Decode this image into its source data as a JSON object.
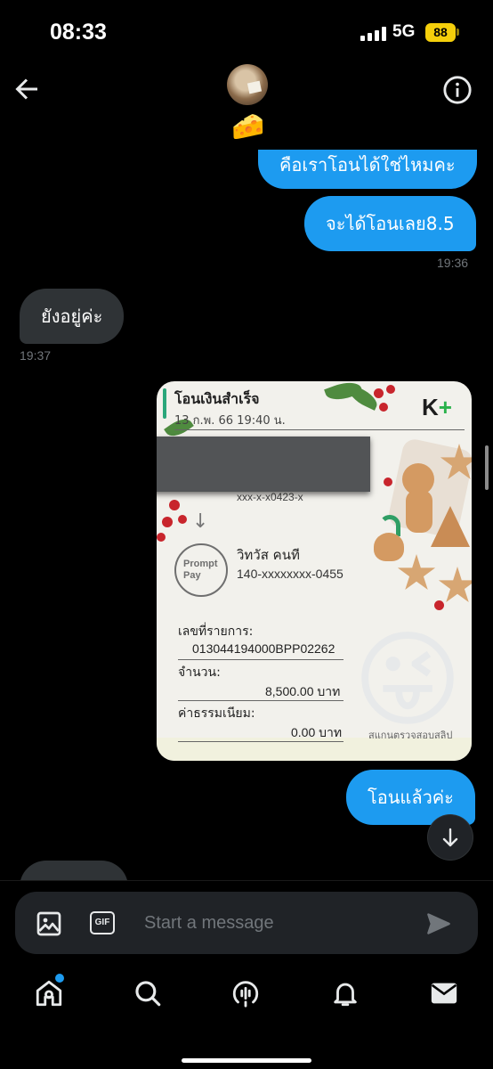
{
  "status_bar": {
    "time": "08:33",
    "network": "5G",
    "battery": "88"
  },
  "header": {
    "contact_emoji": "🧀"
  },
  "messages": [
    {
      "direction": "out",
      "text": "คือเราโอนได้ใช่ไหมคะ"
    },
    {
      "direction": "out",
      "text": "จะได้โอนเลย8.5",
      "time": "19:36"
    },
    {
      "direction": "in",
      "text": "ยังอยู่ค่ะ",
      "time": "19:37"
    },
    {
      "direction": "out",
      "type": "image"
    },
    {
      "direction": "out",
      "text": "โอนแล้วค่ะ"
    }
  ],
  "slip": {
    "title": "โอนเงินสำเร็จ",
    "date": "13 ก.พ. 66  19:40 น.",
    "logo_k": "K",
    "logo_plus": "+",
    "masked_account": "xxx-x-x0423-x",
    "down_arrow": "↓",
    "promptpay_line1": "Prompt",
    "promptpay_line2": "Pay",
    "recipient_name": "วิทวัส คนที",
    "recipient_account": "140-xxxxxxxx-0455",
    "reference_label": "เลขที่รายการ:",
    "reference_value": "013044194000BPP02262",
    "amount_label": "จำนวน:",
    "amount_value": "8,500.00 บาท",
    "fee_label": "ค่าธรรมเนียม:",
    "fee_value": "0.00 บาท",
    "caption": "สแกนตรวจสอบสลิป"
  },
  "sticker": {
    "emoji": "😜"
  },
  "composer": {
    "placeholder": "Start a message",
    "gif_label": "GIF"
  },
  "colors": {
    "accent": "#1d9bf0",
    "incoming_bubble": "#2f3336",
    "background": "#000000",
    "battery": "#f5cf0b"
  },
  "tabs": [
    "home-icon",
    "search-icon",
    "spaces-icon",
    "bell-icon",
    "mail-icon"
  ]
}
